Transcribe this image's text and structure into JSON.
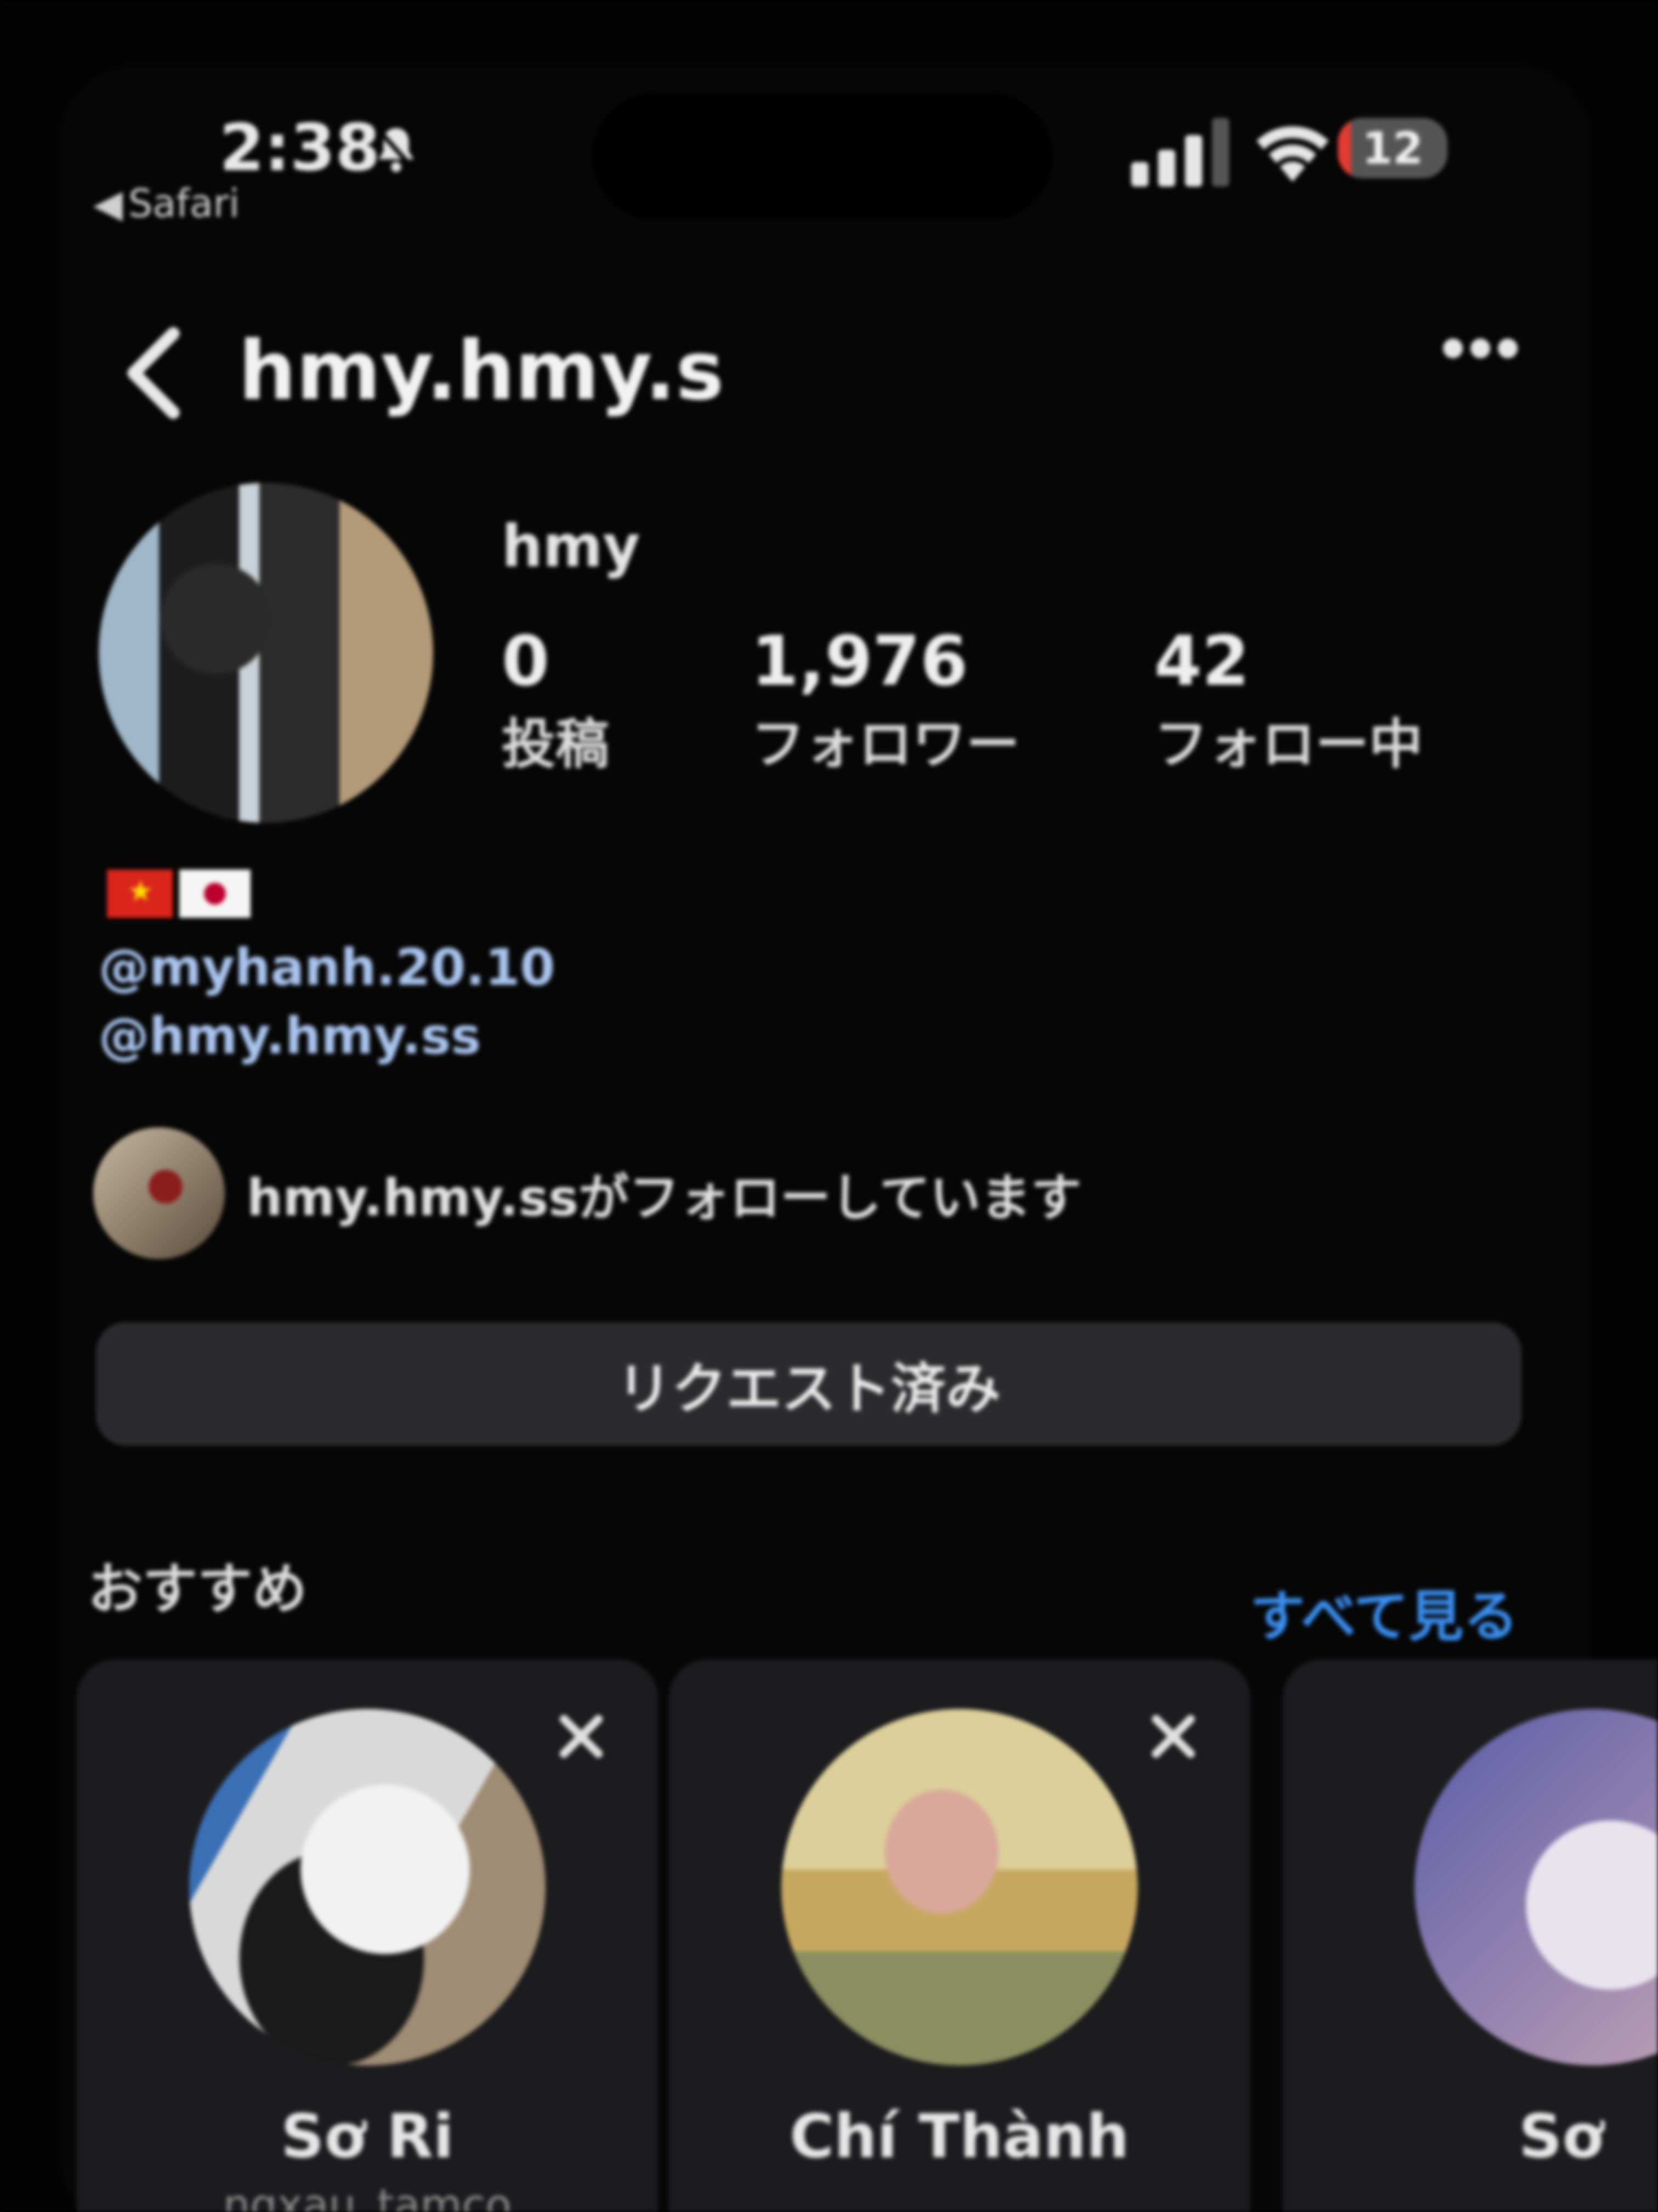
{
  "status_bar": {
    "time": "2:38",
    "back_app": "Safari",
    "battery": "12",
    "battery_level": 0.12,
    "icons": [
      "bell-icon",
      "signal-icon",
      "wifi-icon",
      "battery-icon"
    ]
  },
  "header": {
    "username": "hmy.hmy.s"
  },
  "profile": {
    "display_name": "hmy",
    "stats": [
      {
        "value": "0",
        "label": "投稿"
      },
      {
        "value": "1,976",
        "label": "フォロワー"
      },
      {
        "value": "42",
        "label": "フォロー中"
      }
    ],
    "bio_flags": [
      "Vietnam flag",
      "Japan flag"
    ],
    "mentions": [
      "@myhanh.20.10",
      "@hmy.hmy.ss"
    ],
    "followed_by": "hmy.hmy.ssがフォローしています"
  },
  "actions": {
    "requested_label": "リクエスト済み"
  },
  "suggestions": {
    "title": "おすすめ",
    "see_all": "すべて見る",
    "cards": [
      {
        "name": "Sơ Ri",
        "username": "ngxau_tamco"
      },
      {
        "name": "Chí Thành",
        "username": ""
      },
      {
        "name": "Sơ",
        "username": ""
      }
    ]
  },
  "colors": {
    "background": "#000000",
    "button": "#2b2b2d",
    "link": "#3a8ff2",
    "mention": "#a9c4ee",
    "battery_low": "#e23b32"
  }
}
